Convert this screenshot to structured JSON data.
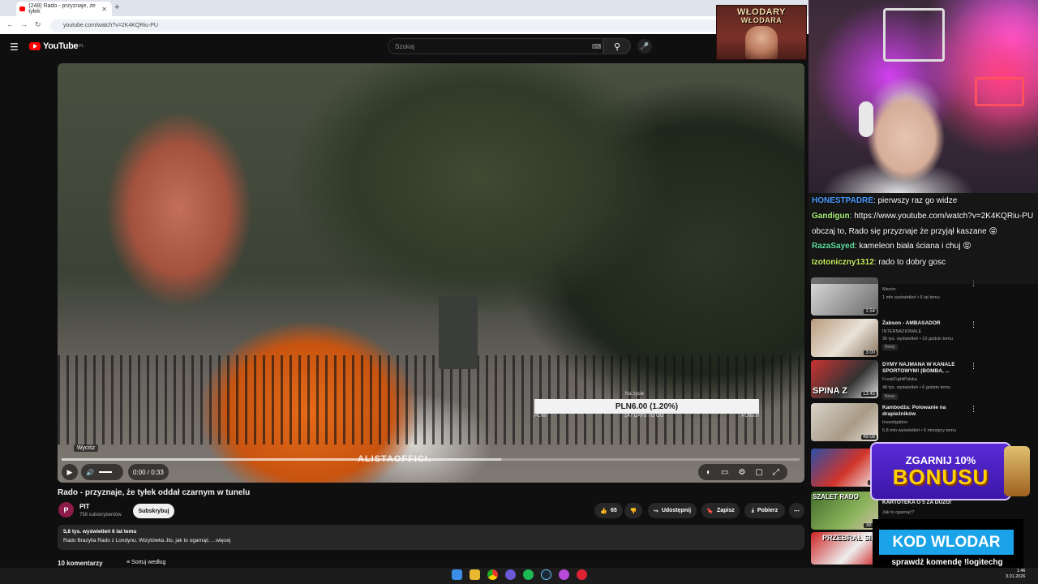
{
  "browser": {
    "tab_title": "(248) Rado - przyznaje, że tyłek",
    "tab_close": "✕",
    "new_tab": "+",
    "url": "youtube.com/watch?v=2K4KQRiu-PU",
    "nav": {
      "back": "←",
      "forward": "→",
      "reload": "↻"
    }
  },
  "youtube": {
    "logo_text": "YouTube",
    "region": "PL",
    "search_placeholder": "Szukaj"
  },
  "video": {
    "ticker_label": "Na życie",
    "ticker_value": "PLN6.00 (1.20%)",
    "ticker_left": "PLN0",
    "ticker_mid": "147 DAYS TO GO",
    "ticker_right": "PLN500",
    "watermark": "ALISTAOFFICI.",
    "tooltip": "Wyciśz",
    "time": "0:00 / 0:33",
    "progress_fraction": 0.0,
    "buffered_fraction": 0.596
  },
  "meta": {
    "title": "Rado - przyznaje, że tyłek oddał czarnym w tunelu",
    "channel": "PIT",
    "avatar_letter": "P",
    "subscribers": "758 subskrybentów",
    "subscribe": "Subskrybuj",
    "likes": "65",
    "share": "Udostępnij",
    "save": "Zapisz",
    "download": "Pobierz",
    "views_date": "5,8 tys. wyświetleń  6 lat temu",
    "description": "Rado Brazylia Rado z Londynu. Wizytówka Jto, jak to ogarnąć. ...więcej",
    "comments": "10 komentarzy",
    "sort": "Sortuj według"
  },
  "sidebar": [
    {
      "title": "",
      "channel": "Marcin",
      "meta": "1 mln wyświetleń • 6 lat temu",
      "duration": "1:54",
      "badge": ""
    },
    {
      "title": "Żabson - AMBASADOR",
      "channel": "INTERNAZIOMALE",
      "meta": "36 tys. wyświetleń • 10 godzin temu",
      "duration": "3:00",
      "badge": "Nowy"
    },
    {
      "title": "DYMY NAJMANA W KANALE SPORTOWYM! (BOMBA, ...",
      "channel": "FreakFightPolska",
      "meta": "48 tys. wyświetleń • 6 godzin temu",
      "duration": "13:45",
      "badge": "Nowy",
      "thumb_text": "SPINA Z"
    },
    {
      "title": "Kambodża: Polowanie na drapieżników",
      "channel": "Investigation",
      "meta": "6,8 mln wyświetleń • 6 miesięcy temu",
      "duration": "49:08",
      "badge": ""
    },
    {
      "title": "",
      "channel": "",
      "meta": "",
      "duration": "20",
      "badge": ""
    },
    {
      "title": "KARTOTEKA O 5 ZA DUZO!",
      "channel": "Jak to ogarnąć?",
      "meta": "",
      "duration": "39:2",
      "badge": "",
      "thumb_text": "SZALET RADO"
    },
    {
      "title": "",
      "channel": "",
      "meta": "",
      "duration": "",
      "badge": "",
      "thumb_text": "PRZEBRAŁ SIĘ"
    }
  ],
  "stream": {
    "badge_text": "WŁODARY",
    "badge_text2": "WŁODARA",
    "chat": [
      {
        "name": "HONESTPADRE",
        "color": "#4a9bff",
        "text": ": pierwszy raz go widze"
      },
      {
        "name": "Gandigun",
        "color": "#a8f07a",
        "text": ": https://www.youtube.com/watch?v=2K4KQRiu-PU obczaj to, Rado się przyznaje że przyjął kaszane 😝"
      },
      {
        "name": "RazaSayed",
        "color": "#5fe0a0",
        "text": ": kameleon biała ściana i chuj 😝"
      },
      {
        "name": "Izotoniczny1312",
        "color": "#c8f060",
        "text": ": rado to dobry gosc"
      }
    ],
    "bonus_line1": "ZGARNIJ 10%",
    "bonus_line2": "BONUSU",
    "code": "KOD WLODAR",
    "code_sub": "sprawdź komendę !logitechg"
  },
  "taskbar": {
    "time": "1:46",
    "date": "3.01.2026"
  }
}
